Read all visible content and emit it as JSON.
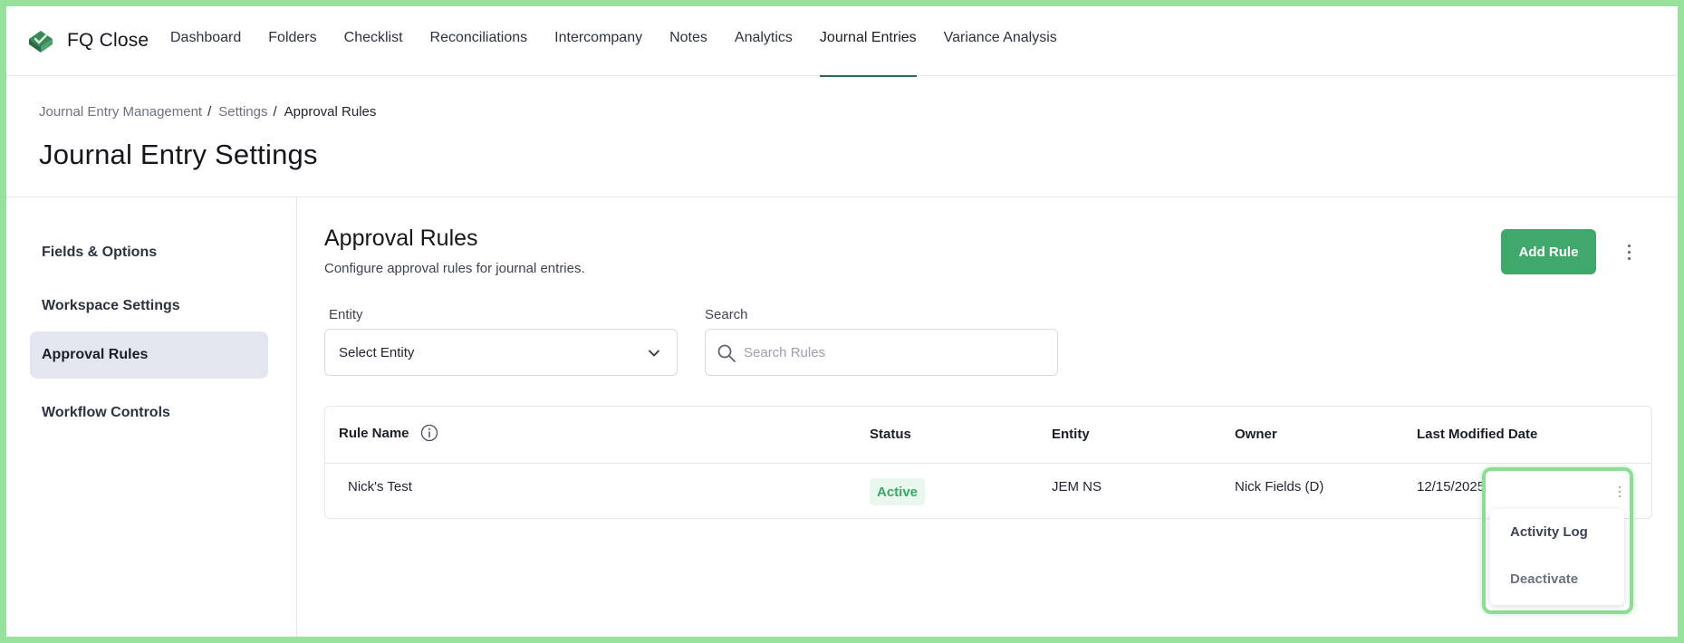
{
  "app": {
    "name": "FQ Close",
    "brand_color": "#2e6b4d"
  },
  "nav": {
    "items": [
      {
        "label": "Dashboard"
      },
      {
        "label": "Folders"
      },
      {
        "label": "Checklist"
      },
      {
        "label": "Reconciliations"
      },
      {
        "label": "Intercompany"
      },
      {
        "label": "Notes"
      },
      {
        "label": "Analytics"
      },
      {
        "label": "Journal Entries",
        "active": true
      },
      {
        "label": "Variance Analysis"
      }
    ]
  },
  "breadcrumb": {
    "items": [
      {
        "label": "Journal Entry Management"
      },
      {
        "label": "Settings"
      },
      {
        "label": "Approval Rules"
      }
    ],
    "separator": "/"
  },
  "page": {
    "title": "Journal Entry Settings"
  },
  "sidebar": {
    "items": [
      {
        "label": "Fields & Options"
      },
      {
        "label": "Workspace Settings"
      },
      {
        "label": "Approval Rules",
        "active": true
      },
      {
        "label": "Workflow Controls"
      }
    ]
  },
  "section": {
    "title": "Approval Rules",
    "subtitle": "Configure approval rules for journal entries.",
    "add_button": "Add Rule"
  },
  "filters": {
    "entity_label": "Entity",
    "entity_value": "Select Entity",
    "search_label": "Search",
    "search_placeholder": "Search Rules",
    "search_value": ""
  },
  "table": {
    "columns": [
      "Rule Name",
      "Status",
      "Entity",
      "Owner",
      "Last Modified Date"
    ],
    "rows": [
      {
        "rule_name": "Nick's Test",
        "status": "Active",
        "entity": "JEM NS",
        "owner": "Nick Fields (D)",
        "last_modified": "12/15/2025"
      }
    ]
  },
  "row_menu": {
    "items": [
      {
        "label": "Activity Log",
        "color": "#3b4454"
      },
      {
        "label": "Deactivate",
        "color": "#6b7280"
      }
    ]
  },
  "colors": {
    "accent_green": "#3fa86a",
    "status_active_text": "#3aa865",
    "status_active_bg": "#eaf7ee",
    "highlight": "#8fdc96"
  }
}
